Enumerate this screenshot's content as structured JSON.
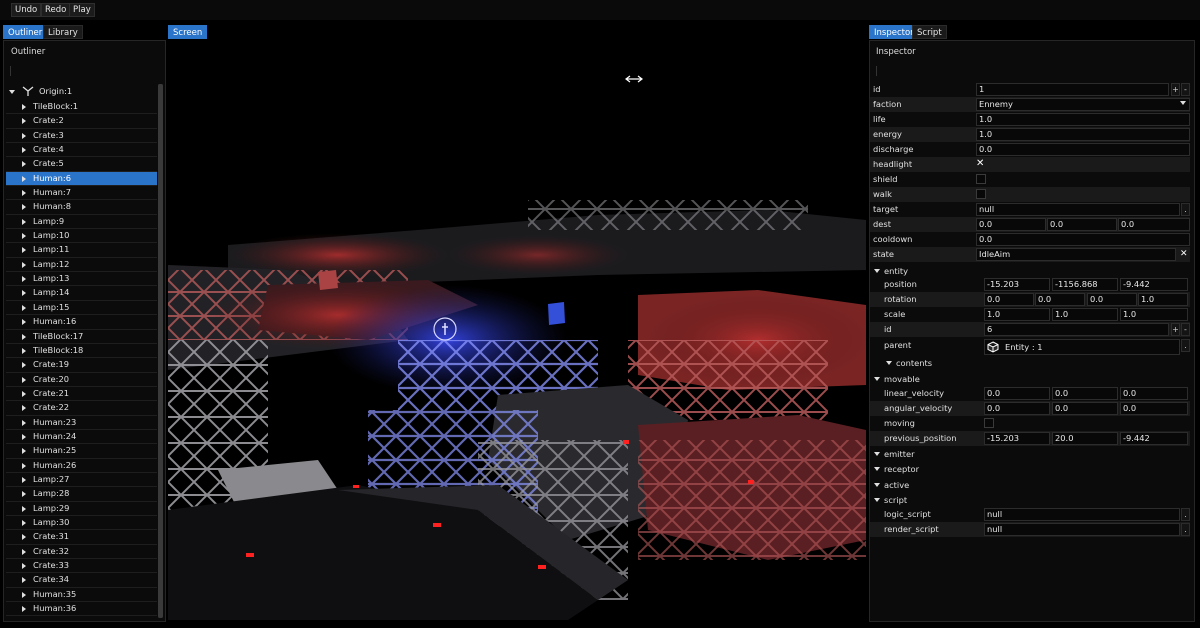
{
  "toolbar": {
    "undo": "Undo",
    "redo": "Redo",
    "play": "Play"
  },
  "left_tabs": [
    "Outliner",
    "Library"
  ],
  "outliner": {
    "title": "Outliner",
    "root": "Origin:1",
    "items": [
      "TileBlock:1",
      "Crate:2",
      "Crate:3",
      "Crate:4",
      "Crate:5",
      "Human:6",
      "Human:7",
      "Human:8",
      "Lamp:9",
      "Lamp:10",
      "Lamp:11",
      "Lamp:12",
      "Lamp:13",
      "Lamp:14",
      "Lamp:15",
      "Human:16",
      "TileBlock:17",
      "TileBlock:18",
      "Crate:19",
      "Crate:20",
      "Crate:21",
      "Crate:22",
      "Human:23",
      "Human:24",
      "Human:25",
      "Human:26",
      "Lamp:27",
      "Lamp:28",
      "Lamp:29",
      "Lamp:30",
      "Crate:31",
      "Crate:32",
      "Crate:33",
      "Crate:34",
      "Human:35",
      "Human:36"
    ],
    "selected": "Human:6"
  },
  "viewport": {
    "tab": "Screen",
    "tools": [
      "skip-back-icon",
      "skip-forward-icon",
      "move-icon",
      "rotate-icon",
      "target-icon"
    ]
  },
  "right_tabs": [
    "Inspector",
    "Script"
  ],
  "inspector": {
    "title": "Inspector",
    "id": "1",
    "faction_label": "faction",
    "faction": "Ennemy",
    "life_label": "life",
    "life": "1.0",
    "energy_label": "energy",
    "energy": "1.0",
    "discharge_label": "discharge",
    "discharge": "0.0",
    "headlight_label": "headlight",
    "headlight": "✕",
    "shield_label": "shield",
    "walk_label": "walk",
    "target_label": "target",
    "target": "null",
    "dest_label": "dest",
    "dest": [
      "0.0",
      "0.0",
      "0.0"
    ],
    "cooldown_label": "cooldown",
    "cooldown": "0.0",
    "state_label": "state",
    "state": "IdleAim",
    "entity": {
      "label": "entity",
      "position_label": "position",
      "position": [
        "-15.203",
        "-1156.868",
        "-9.442"
      ],
      "rotation_label": "rotation",
      "rotation": [
        "0.0",
        "0.0",
        "0.0",
        "1.0"
      ],
      "scale_label": "scale",
      "scale": [
        "1.0",
        "1.0",
        "1.0"
      ],
      "id_label": "id",
      "id": "6",
      "parent_label": "parent",
      "parent": "Entity : 1",
      "contents_label": "contents"
    },
    "movable": {
      "label": "movable",
      "linear_velocity_label": "linear_velocity",
      "linear_velocity": [
        "0.0",
        "0.0",
        "0.0"
      ],
      "angular_velocity_label": "angular_velocity",
      "angular_velocity": [
        "0.0",
        "0.0",
        "0.0"
      ],
      "moving_label": "moving",
      "previous_position_label": "previous_position",
      "previous_position": [
        "-15.203",
        "20.0",
        "-9.442"
      ]
    },
    "emitter_label": "emitter",
    "receptor_label": "receptor",
    "active_label": "active",
    "script": {
      "label": "script",
      "logic_script_label": "logic_script",
      "logic_script": "null",
      "render_script_label": "render_script",
      "render_script": "null"
    },
    "id_label": "id",
    "plus": "+",
    "minus": "-",
    "dot": "."
  }
}
